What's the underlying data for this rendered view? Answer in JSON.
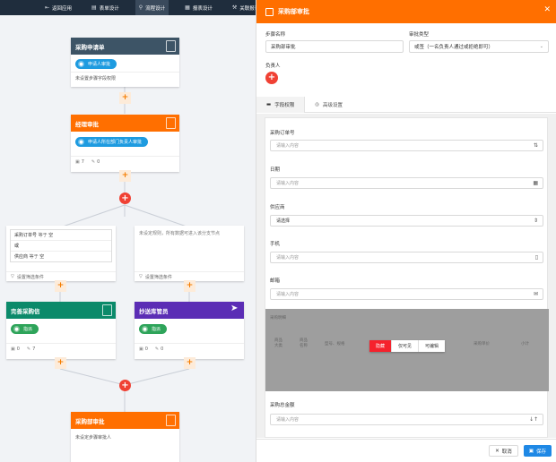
{
  "nav": {
    "items": [
      {
        "label": "返回应用",
        "icon": "back-icon"
      },
      {
        "label": "表单设计",
        "icon": "form-icon"
      },
      {
        "label": "流程设计",
        "icon": "flow-icon"
      },
      {
        "label": "报表设计",
        "icon": "report-icon"
      },
      {
        "label": "关联报表",
        "icon": "link-report-icon"
      }
    ]
  },
  "flow": {
    "start": {
      "title": "采购申请单",
      "pill": "申请人审批",
      "text": "未设置步骤字段权限"
    },
    "manager": {
      "title": "经理审批",
      "pill": "申请人所在部门负责人审批",
      "views": "7",
      "edits": "0"
    },
    "cond_left": {
      "rows": [
        {
          "field": "采购订单号",
          "op": "等于",
          "val": "空"
        },
        {
          "field": "或",
          "op": "",
          "val": ""
        },
        {
          "field": "供应商",
          "op": "等于",
          "val": "空"
        }
      ],
      "filter": "设置筛选条件"
    },
    "cond_right": {
      "note": "未设定规则，所有数据可进入该分支节点",
      "filter": "设置筛选条件"
    },
    "complete": {
      "title": "完善采购信",
      "pill": "指派",
      "views": "0",
      "edits": "7"
    },
    "cc": {
      "title": "抄送库管员",
      "pill": "指派",
      "views": "0",
      "edits": "0"
    },
    "dept": {
      "title": "采购部审批",
      "text": "未设定步骤审批人"
    }
  },
  "panel": {
    "title": "采购部审批",
    "step_name_label": "步骤名称",
    "step_name_value": "采购部审批",
    "approve_type_label": "审批类型",
    "approve_type_value": "或签（一名负责人通过或拒绝即可）",
    "owner_label": "负责人",
    "tabs": [
      {
        "label": "字段权限",
        "icon": "list-icon"
      },
      {
        "label": "高级设置",
        "icon": "settings-icon"
      }
    ],
    "fields": [
      {
        "label": "采购订单号",
        "placeholder": "请输入内容",
        "icon": "sort-icon"
      },
      {
        "label": "日期",
        "placeholder": "请输入内容",
        "icon": "calendar-icon"
      },
      {
        "label": "供应商",
        "placeholder": "请选择",
        "icon": "select-icon"
      },
      {
        "label": "手机",
        "placeholder": "请输入内容",
        "icon": "phone-icon"
      },
      {
        "label": "邮箱",
        "placeholder": "请输入内容",
        "icon": "mail-icon"
      },
      {
        "label": "采购总金额",
        "placeholder": "请输入内容",
        "icon": "amount-icon"
      }
    ],
    "ghost": {
      "title": "采购明细",
      "cols": [
        "商品大类",
        "商品名称",
        "型号、规格",
        "",
        "采购单价",
        "小计"
      ]
    },
    "perms": [
      "隐藏",
      "仅可见",
      "可编辑"
    ],
    "cancel": "取消",
    "save": "保存"
  },
  "colors": {
    "nav": "#1f2d3d",
    "blue_head": "#3d5466",
    "orange": "#ff6f00",
    "teal": "#0b8a6a",
    "purple": "#5b2db5",
    "red": "#f04134",
    "pill_green": "#2ea45a",
    "pill_blue": "#1e9be0",
    "save": "#1e88e5"
  }
}
